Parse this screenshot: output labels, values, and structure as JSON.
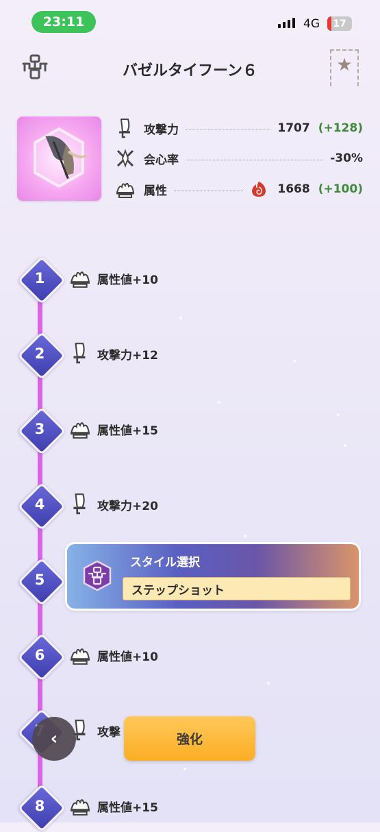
{
  "status_bar": {
    "time": "23:11",
    "network": "4G",
    "battery": "17",
    "battery_level": 0.17
  },
  "header": {
    "title": "バゼルタイフーン６",
    "icon": "weapon-tree-icon",
    "favorite_icon": "star-bookmark-icon"
  },
  "weapon": {
    "image": "bow-weapon-icon"
  },
  "stats": [
    {
      "icon": "attack-icon",
      "label": "攻撃力",
      "value": "1707",
      "bonus": "(+128)"
    },
    {
      "icon": "affinity-icon",
      "label": "会心率",
      "value": "-30%",
      "bonus": ""
    },
    {
      "icon": "element-icon",
      "label": "属性",
      "element_icon": "fire-icon",
      "value": "1668",
      "bonus": "(+100)"
    }
  ],
  "timeline": {
    "steps": [
      {
        "number": "1",
        "icon": "element-icon",
        "label": "属性値+10"
      },
      {
        "number": "2",
        "icon": "attack-icon",
        "label": "攻撃力+12"
      },
      {
        "number": "3",
        "icon": "element-icon",
        "label": "属性値+15"
      },
      {
        "number": "4",
        "icon": "attack-icon",
        "label": "攻撃力+20"
      },
      {
        "number": "5",
        "style_select": {
          "title": "スタイル選択",
          "value": "ステップショット",
          "icon": "style-emblem-icon"
        }
      },
      {
        "number": "6",
        "icon": "element-icon",
        "label": "属性値+10"
      },
      {
        "number": "7",
        "icon": "attack-icon",
        "label": "攻撃"
      },
      {
        "number": "8",
        "icon": "element-icon",
        "label": "属性値+15"
      }
    ]
  },
  "buttons": {
    "back": "‹",
    "enhance": "強化"
  },
  "colors": {
    "accent_green": "#3cc45a",
    "bonus_green": "#3e8a3a",
    "timeline": "#d765e5",
    "node": "#4b4bc0",
    "enhance": "#fbae25"
  }
}
